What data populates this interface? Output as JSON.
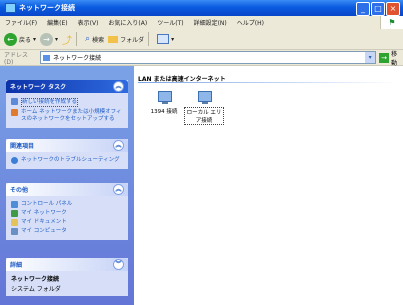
{
  "window": {
    "title": "ネットワーク接続",
    "buttons": [
      "_",
      "□",
      "×"
    ]
  },
  "menu": [
    "ファイル(F)",
    "編集(E)",
    "表示(V)",
    "お気に入り(A)",
    "ツール(T)",
    "詳細設定(N)",
    "ヘルプ(H)"
  ],
  "toolbar": {
    "back": "戻る",
    "search": "検索",
    "folders": "フォルダ"
  },
  "address": {
    "label": "アドレス(D)",
    "value": "ネットワーク接続",
    "go": "移動"
  },
  "sidebar": {
    "tasks": {
      "title": "ネットワーク タスク",
      "items": [
        "新しい接続を作成する",
        "ホーム ネットワークまたは小規模オフィスのネットワークをセットアップする"
      ]
    },
    "related": {
      "title": "関連項目",
      "items": [
        "ネットワークのトラブルシューティング"
      ]
    },
    "other": {
      "title": "その他",
      "items": [
        "コントロール パネル",
        "マイ ネットワーク",
        "マイ ドキュメント",
        "マイ コンピュータ"
      ]
    },
    "details": {
      "title": "詳細",
      "name": "ネットワーク接続",
      "type": "システム フォルダ"
    }
  },
  "main": {
    "group_title": "LAN または高速インターネット",
    "connections": [
      {
        "label": "1394 接続"
      },
      {
        "label": "ローカル エリア接続"
      }
    ]
  },
  "colors": {
    "titlebar": "#0b5be0",
    "sidebar": "#6f8fe0",
    "link": "#215dc6"
  }
}
